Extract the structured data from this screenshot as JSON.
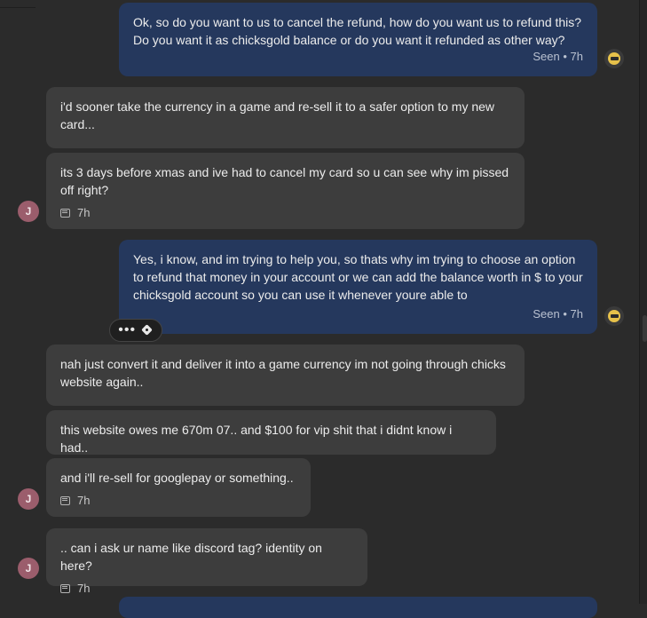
{
  "messages": [
    {
      "sender": "agent",
      "text": "Ok, so do you want to us to cancel the refund, how do you want us to refund this? Do you want it as chicksgold balance or do you want it refunded as other way?",
      "status": "Seen • 7h"
    },
    {
      "sender": "user",
      "text": "i'd sooner take the currency in a game and re-sell it to a safer option to my new card..."
    },
    {
      "sender": "user",
      "text": "its 3 days before xmas and ive had to cancel my card so u can see why im pissed off right?",
      "time": "7h",
      "avatar": "J"
    },
    {
      "sender": "agent",
      "text": "Yes, i know, and im trying to help you, so thats why im trying to choose an option to refund that money in your account or we can add the balance worth in $ to your chicksgold account so you can use it whenever youre able to",
      "status": "Seen • 7h"
    },
    {
      "sender": "user",
      "text": "nah just convert it and deliver it into a game currency im not going through chicks website again.."
    },
    {
      "sender": "user",
      "text": "this website owes me 670m 07.. and $100 for vip shit that i didnt know i had.."
    },
    {
      "sender": "user",
      "text": "and i'll re-sell for googlepay or something..",
      "time": "7h",
      "avatar": "J"
    },
    {
      "sender": "user",
      "text": ".. can i ask ur name like discord tag? identity on here?",
      "time": "7h",
      "avatar": "J"
    }
  ],
  "action_bar": {
    "more_label": "•••"
  },
  "icons": {
    "avatar_agent": "agent-avatar-icon",
    "message_time": "chat-bubble-icon",
    "tag": "tag-icon",
    "more": "more-icon"
  },
  "colors": {
    "background": "#2b2b2b",
    "incoming_bubble": "#3d3d3d",
    "outgoing_bubble": "#25385d",
    "avatar": "#9b5d6c"
  }
}
